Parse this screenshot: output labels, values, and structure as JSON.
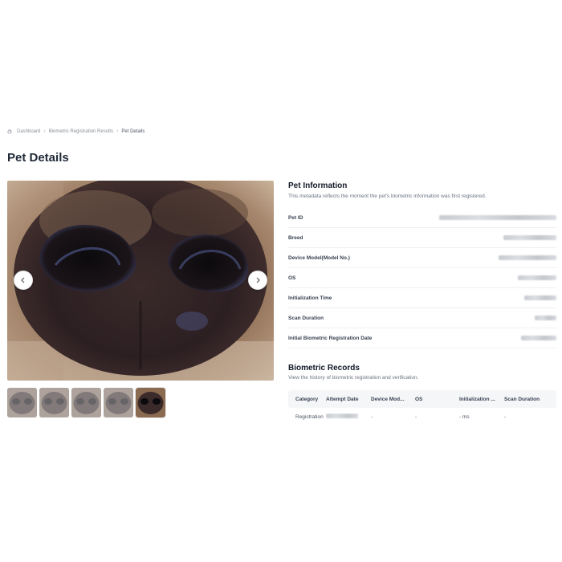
{
  "breadcrumb": {
    "items": [
      "Dashboard",
      "Biometric Registration Results",
      "Pet Details"
    ],
    "icon": "dashboard-icon"
  },
  "page": {
    "title": "Pet Details"
  },
  "gallery": {
    "thumbnail_count": 5,
    "active_index": 4,
    "prev_icon": "chevron-left-icon",
    "next_icon": "chevron-right-icon"
  },
  "pet_info": {
    "title": "Pet Information",
    "description": "This metadata reflects the moment the pet's biometric information was first registered.",
    "rows": [
      {
        "label": "Pet ID"
      },
      {
        "label": "Breed"
      },
      {
        "label": "Device Model(Model No.)"
      },
      {
        "label": "OS"
      },
      {
        "label": "Initialization Time"
      },
      {
        "label": "Scan Duration"
      },
      {
        "label": "Initial Biometric Registration Date"
      }
    ]
  },
  "biometric_records": {
    "title": "Biometric Records",
    "description": "View the history of biometric registration and verification.",
    "columns": [
      "Category",
      "Attempt Date",
      "Device Mod...",
      "OS",
      "Initialization ...",
      "Scan Duration"
    ],
    "rows": [
      {
        "category": "Registration",
        "device_model": "-",
        "os": "-",
        "init": "- ms",
        "scan": "-"
      }
    ]
  },
  "colors": {
    "text": "#1f2937",
    "muted": "#6b7280",
    "border": "#eef0f2",
    "header_bg": "#f5f6f8"
  }
}
